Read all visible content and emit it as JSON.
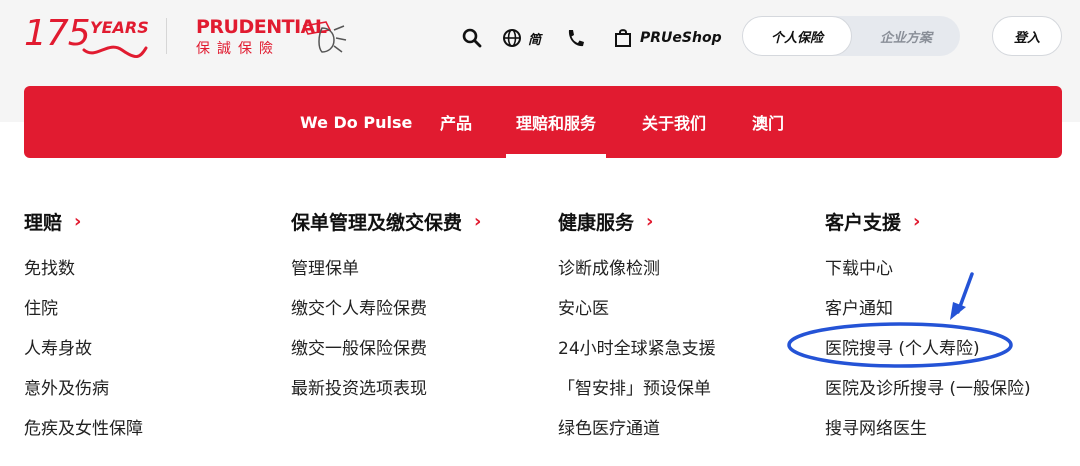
{
  "header": {
    "anniversary": {
      "number": "175",
      "word": "YEARS"
    },
    "brand": {
      "name_en": "PRUDENTIAL",
      "name_zh": "保誠保險"
    },
    "lang_label": "简",
    "shop_label": "PRUeShop",
    "segments": [
      {
        "label": "个人保险",
        "active": true
      },
      {
        "label": "企业方案",
        "active": false
      }
    ],
    "login_label": "登入",
    "icons": [
      "search-icon",
      "globe-icon",
      "phone-icon",
      "shopping-bag-icon"
    ]
  },
  "nav": {
    "items": [
      {
        "label": "We Do Pulse",
        "active": false
      },
      {
        "label": "产品",
        "active": false
      },
      {
        "label": "理赔和服务",
        "active": true
      },
      {
        "label": "关于我们",
        "active": false
      },
      {
        "label": "澳门",
        "active": false
      }
    ]
  },
  "menu": {
    "columns": [
      {
        "heading": "理赔",
        "links": [
          "免找数",
          "住院",
          "人寿身故",
          "意外及伤病",
          "危疾及女性保障"
        ]
      },
      {
        "heading": "保单管理及缴交保费",
        "links": [
          "管理保单",
          "缴交个人寿险保费",
          "缴交一般保险保费",
          "最新投资选项表现"
        ]
      },
      {
        "heading": "健康服务",
        "links": [
          "诊断成像检测",
          "安心医",
          "24小时全球紧急支援",
          "「智安排」预设保单",
          "绿色医疗通道"
        ]
      },
      {
        "heading": "客户支援",
        "links": [
          "下载中心",
          "客户通知",
          "医院搜寻 (个人寿险)",
          "医院及诊所搜寻 (一般保险)",
          "搜寻网络医生"
        ]
      }
    ]
  },
  "colors": {
    "brand_red": "#e11b30",
    "annotation_blue": "#2453d6"
  },
  "annotation": {
    "highlighted_link": "医院搜寻 (个人寿险)"
  }
}
